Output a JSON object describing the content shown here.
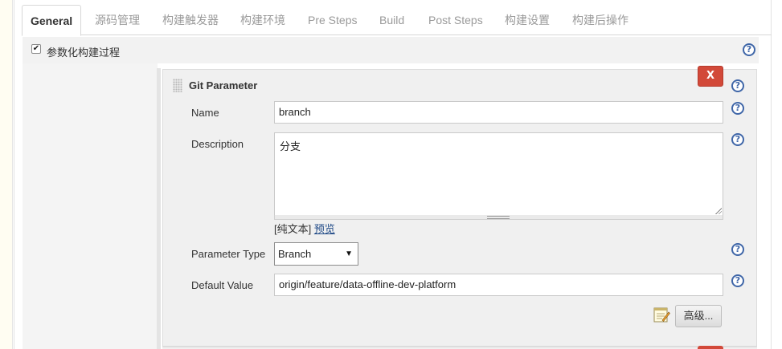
{
  "tabs": [
    {
      "label": "General",
      "active": true
    },
    {
      "label": "源码管理",
      "active": false
    },
    {
      "label": "构建触发器",
      "active": false
    },
    {
      "label": "构建环境",
      "active": false
    },
    {
      "label": "Pre Steps",
      "active": false
    },
    {
      "label": "Build",
      "active": false
    },
    {
      "label": "Post Steps",
      "active": false
    },
    {
      "label": "构建设置",
      "active": false
    },
    {
      "label": "构建后操作",
      "active": false
    }
  ],
  "section": {
    "checkbox_checked": true,
    "label": "参数化构建过程"
  },
  "parameter": {
    "title": "Git Parameter",
    "delete_label": "X",
    "name_label": "Name",
    "name_value": "branch",
    "description_label": "Description",
    "description_value": "分支",
    "plain_text_label": "[纯文本]",
    "preview_label": "预览",
    "type_label": "Parameter Type",
    "type_value": "Branch",
    "default_label": "Default Value",
    "default_value": "origin/feature/data-offline-dev-platform",
    "advanced_label": "高级..."
  },
  "icons": {
    "help": "help-icon",
    "drag": "drag-handle-icon",
    "notepad": "notepad-icon"
  },
  "colors": {
    "delete_button": "#d24939",
    "help_icon": "#3f66a8",
    "link": "#204a87"
  }
}
